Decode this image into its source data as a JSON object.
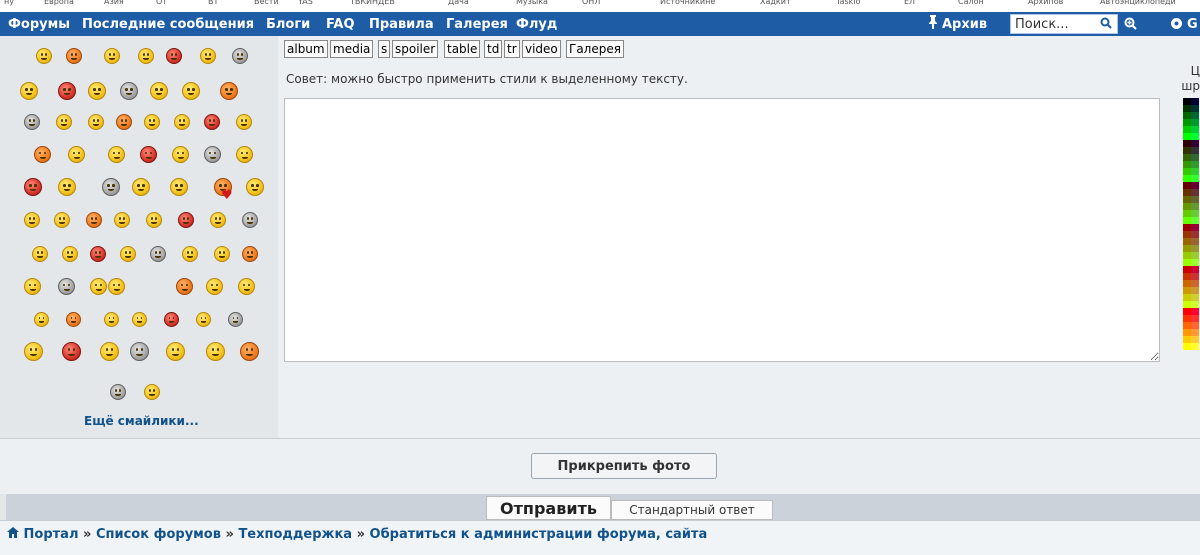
{
  "top_strip": [
    "ну",
    "Европа",
    "Азия",
    "ОТ",
    "ВТ",
    "Вести",
    "YAS",
    "ТВКИНДЕВ",
    "Дача",
    "Музыка",
    "ОНЛ",
    "Источникине",
    "Хадкит",
    "Taskio",
    "ЕЛ",
    "Салон",
    "Архипов",
    "Автоэнциклопеди"
  ],
  "nav": {
    "links": [
      "Форумы",
      "Последние сообщения",
      "Блоги",
      "FAQ",
      "Правила",
      "Галерея",
      "Флуд"
    ],
    "archive_label": "Архив",
    "search_placeholder": "Поиск...",
    "icons": [
      "pin-icon",
      "search-icon",
      "advanced-search-icon",
      "settings-icon"
    ],
    "trailing_letter": "G"
  },
  "smilies": {
    "more_label": "Ещё смайлики..."
  },
  "editor": {
    "bbcodes": [
      "album",
      "media",
      "s",
      "spoiler",
      "table",
      "td",
      "tr",
      "video",
      "Галерея"
    ],
    "tip": "Совет: можно быстро применить стили к выделенному тексту.",
    "message_value": "",
    "color_label_line1": "Ц",
    "color_label_line2": "шр"
  },
  "buttons": {
    "attach_photo": "Прикрепить фото",
    "submit": "Отправить",
    "template_reply": "Стандартный ответ"
  },
  "breadcrumbs": {
    "items": [
      "Портал",
      "Список форумов",
      "Техподдержка",
      "Обратиться к администрации форума, сайта"
    ],
    "separator": "»",
    "home_icon": "home-icon"
  },
  "colors": {
    "nav_bg": "#1e5da6",
    "link": "#105289",
    "palette_columns": [
      [
        "#000000",
        "#003300",
        "#006600",
        "#009900",
        "#00cc00",
        "#00ff00",
        "#330000",
        "#333300",
        "#336600",
        "#339900",
        "#33cc00",
        "#33ff00",
        "#660000",
        "#663300",
        "#666600",
        "#669900",
        "#66cc00",
        "#66ff00",
        "#990000",
        "#993300",
        "#996600",
        "#999900",
        "#99cc00",
        "#99ff00",
        "#cc0000",
        "#cc3300",
        "#cc6600",
        "#cc9900",
        "#cccc00",
        "#ccff00",
        "#ff0000",
        "#ff3300",
        "#ff6600",
        "#ff9900",
        "#ffcc00",
        "#ffff00"
      ],
      [
        "#000033",
        "#003333",
        "#006633",
        "#009933",
        "#00cc33",
        "#00ff33",
        "#330033",
        "#333333",
        "#336633",
        "#339933",
        "#33cc33",
        "#33ff33",
        "#660033",
        "#663333",
        "#666633",
        "#669933",
        "#66cc33",
        "#66ff33",
        "#990033",
        "#993333",
        "#996633",
        "#999933",
        "#99cc33",
        "#99ff33",
        "#cc0033",
        "#cc3333",
        "#cc6633",
        "#cc9933",
        "#cccc33",
        "#ccff33",
        "#ff0033",
        "#ff3333",
        "#ff6633",
        "#ff9933",
        "#ffcc33",
        "#ffff33"
      ]
    ]
  }
}
